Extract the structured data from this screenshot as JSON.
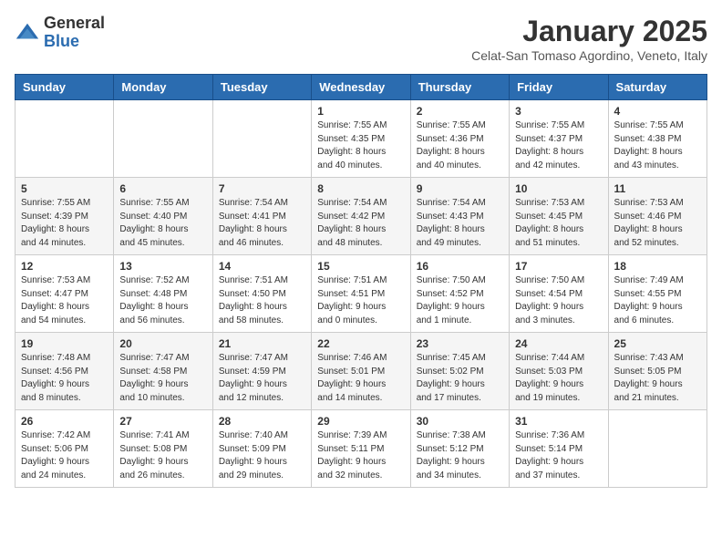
{
  "header": {
    "logo_general": "General",
    "logo_blue": "Blue",
    "month_year": "January 2025",
    "location": "Celat-San Tomaso Agordino, Veneto, Italy"
  },
  "weekdays": [
    "Sunday",
    "Monday",
    "Tuesday",
    "Wednesday",
    "Thursday",
    "Friday",
    "Saturday"
  ],
  "weeks": [
    [
      {
        "day": "",
        "info": ""
      },
      {
        "day": "",
        "info": ""
      },
      {
        "day": "",
        "info": ""
      },
      {
        "day": "1",
        "info": "Sunrise: 7:55 AM\nSunset: 4:35 PM\nDaylight: 8 hours\nand 40 minutes."
      },
      {
        "day": "2",
        "info": "Sunrise: 7:55 AM\nSunset: 4:36 PM\nDaylight: 8 hours\nand 40 minutes."
      },
      {
        "day": "3",
        "info": "Sunrise: 7:55 AM\nSunset: 4:37 PM\nDaylight: 8 hours\nand 42 minutes."
      },
      {
        "day": "4",
        "info": "Sunrise: 7:55 AM\nSunset: 4:38 PM\nDaylight: 8 hours\nand 43 minutes."
      }
    ],
    [
      {
        "day": "5",
        "info": "Sunrise: 7:55 AM\nSunset: 4:39 PM\nDaylight: 8 hours\nand 44 minutes."
      },
      {
        "day": "6",
        "info": "Sunrise: 7:55 AM\nSunset: 4:40 PM\nDaylight: 8 hours\nand 45 minutes."
      },
      {
        "day": "7",
        "info": "Sunrise: 7:54 AM\nSunset: 4:41 PM\nDaylight: 8 hours\nand 46 minutes."
      },
      {
        "day": "8",
        "info": "Sunrise: 7:54 AM\nSunset: 4:42 PM\nDaylight: 8 hours\nand 48 minutes."
      },
      {
        "day": "9",
        "info": "Sunrise: 7:54 AM\nSunset: 4:43 PM\nDaylight: 8 hours\nand 49 minutes."
      },
      {
        "day": "10",
        "info": "Sunrise: 7:53 AM\nSunset: 4:45 PM\nDaylight: 8 hours\nand 51 minutes."
      },
      {
        "day": "11",
        "info": "Sunrise: 7:53 AM\nSunset: 4:46 PM\nDaylight: 8 hours\nand 52 minutes."
      }
    ],
    [
      {
        "day": "12",
        "info": "Sunrise: 7:53 AM\nSunset: 4:47 PM\nDaylight: 8 hours\nand 54 minutes."
      },
      {
        "day": "13",
        "info": "Sunrise: 7:52 AM\nSunset: 4:48 PM\nDaylight: 8 hours\nand 56 minutes."
      },
      {
        "day": "14",
        "info": "Sunrise: 7:51 AM\nSunset: 4:50 PM\nDaylight: 8 hours\nand 58 minutes."
      },
      {
        "day": "15",
        "info": "Sunrise: 7:51 AM\nSunset: 4:51 PM\nDaylight: 9 hours\nand 0 minutes."
      },
      {
        "day": "16",
        "info": "Sunrise: 7:50 AM\nSunset: 4:52 PM\nDaylight: 9 hours\nand 1 minute."
      },
      {
        "day": "17",
        "info": "Sunrise: 7:50 AM\nSunset: 4:54 PM\nDaylight: 9 hours\nand 3 minutes."
      },
      {
        "day": "18",
        "info": "Sunrise: 7:49 AM\nSunset: 4:55 PM\nDaylight: 9 hours\nand 6 minutes."
      }
    ],
    [
      {
        "day": "19",
        "info": "Sunrise: 7:48 AM\nSunset: 4:56 PM\nDaylight: 9 hours\nand 8 minutes."
      },
      {
        "day": "20",
        "info": "Sunrise: 7:47 AM\nSunset: 4:58 PM\nDaylight: 9 hours\nand 10 minutes."
      },
      {
        "day": "21",
        "info": "Sunrise: 7:47 AM\nSunset: 4:59 PM\nDaylight: 9 hours\nand 12 minutes."
      },
      {
        "day": "22",
        "info": "Sunrise: 7:46 AM\nSunset: 5:01 PM\nDaylight: 9 hours\nand 14 minutes."
      },
      {
        "day": "23",
        "info": "Sunrise: 7:45 AM\nSunset: 5:02 PM\nDaylight: 9 hours\nand 17 minutes."
      },
      {
        "day": "24",
        "info": "Sunrise: 7:44 AM\nSunset: 5:03 PM\nDaylight: 9 hours\nand 19 minutes."
      },
      {
        "day": "25",
        "info": "Sunrise: 7:43 AM\nSunset: 5:05 PM\nDaylight: 9 hours\nand 21 minutes."
      }
    ],
    [
      {
        "day": "26",
        "info": "Sunrise: 7:42 AM\nSunset: 5:06 PM\nDaylight: 9 hours\nand 24 minutes."
      },
      {
        "day": "27",
        "info": "Sunrise: 7:41 AM\nSunset: 5:08 PM\nDaylight: 9 hours\nand 26 minutes."
      },
      {
        "day": "28",
        "info": "Sunrise: 7:40 AM\nSunset: 5:09 PM\nDaylight: 9 hours\nand 29 minutes."
      },
      {
        "day": "29",
        "info": "Sunrise: 7:39 AM\nSunset: 5:11 PM\nDaylight: 9 hours\nand 32 minutes."
      },
      {
        "day": "30",
        "info": "Sunrise: 7:38 AM\nSunset: 5:12 PM\nDaylight: 9 hours\nand 34 minutes."
      },
      {
        "day": "31",
        "info": "Sunrise: 7:36 AM\nSunset: 5:14 PM\nDaylight: 9 hours\nand 37 minutes."
      },
      {
        "day": "",
        "info": ""
      }
    ]
  ]
}
